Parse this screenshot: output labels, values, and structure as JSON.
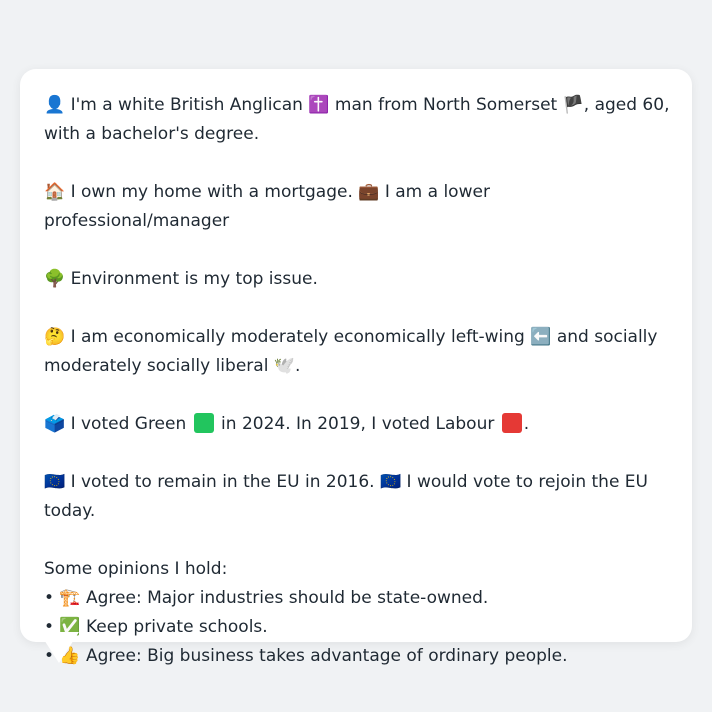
{
  "profile": {
    "identity_pre": "👤 I'm a white British Anglican ",
    "identity_religion_icon": "✝️",
    "identity_mid": " man from North Somerset ",
    "identity_flag": "🏴",
    "identity_post": ", aged 60, with a bachelor's degree.",
    "housing": "🏠 I own my home with a mortgage. 💼 I am a lower professional/manager",
    "issue": "🌳 Environment is my top issue.",
    "ideology_pre": "🤔 I am economically moderately economically left-wing ",
    "ideology_arrow": "⬅️",
    "ideology_post": " and socially moderately socially liberal ",
    "ideology_dove": "🕊️",
    "ideology_end": ".",
    "vote_pre": "🗳️ I voted Green ",
    "vote_mid": " in 2024. In 2019, I voted Labour ",
    "vote_end": ".",
    "eu": "🇪🇺 I voted to remain in the EU in 2016. 🇪🇺 I would vote to rejoin the EU today.",
    "opinions_heading": "Some opinions I hold:",
    "opinions": [
      "• 🏗️ Agree: Major industries should be state-owned.",
      "• ✅ Keep private schools.",
      "• 👍 Agree: Big business takes advantage of ordinary people."
    ]
  },
  "colors": {
    "green_party": "#22c55e",
    "labour": "#e53935",
    "background": "#f0f2f4",
    "bubble": "#ffffff",
    "text": "#1f2933"
  }
}
